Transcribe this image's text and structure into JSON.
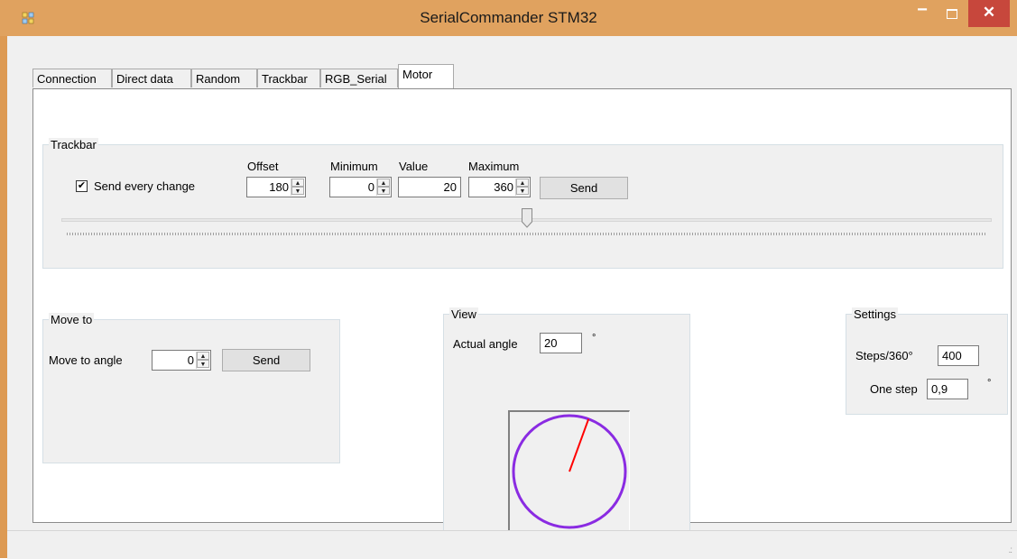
{
  "window": {
    "title": "SerialCommander STM32",
    "minimize": "−",
    "close": "✕"
  },
  "tabs": [
    "Connection",
    "Direct data",
    "Random",
    "Trackbar",
    "RGB_Serial",
    "Motor"
  ],
  "active_tab": "Motor",
  "trackbar_group": {
    "title": "Trackbar",
    "send_every_change_label": "Send every change",
    "send_every_change_checked": true,
    "check_glyph": "✔",
    "offset_label": "Offset",
    "offset_value": "180",
    "minimum_label": "Minimum",
    "minimum_value": "0",
    "value_label": "Value",
    "value_value": "20",
    "maximum_label": "Maximum",
    "maximum_value": "360",
    "send_label": "Send",
    "slider_value": 180,
    "slider_min": 0,
    "slider_max": 360
  },
  "move_to_group": {
    "title": "Move to",
    "angle_label": "Move to angle",
    "angle_value": "0",
    "send_label": "Send"
  },
  "view_group": {
    "title": "View",
    "actual_angle_label": "Actual angle",
    "actual_angle_value": "20",
    "degree_symbol": "°",
    "dial_angle_deg": 20,
    "circle_color": "#8a2be2",
    "needle_color": "#ff0000"
  },
  "settings_group": {
    "title": "Settings",
    "steps_label": "Steps/360°",
    "steps_value": "400",
    "one_step_label": "One step",
    "one_step_value": "0,9",
    "degree_symbol": "°"
  },
  "spin_up": "▲",
  "spin_down": "▼",
  "status_grip": ".:"
}
